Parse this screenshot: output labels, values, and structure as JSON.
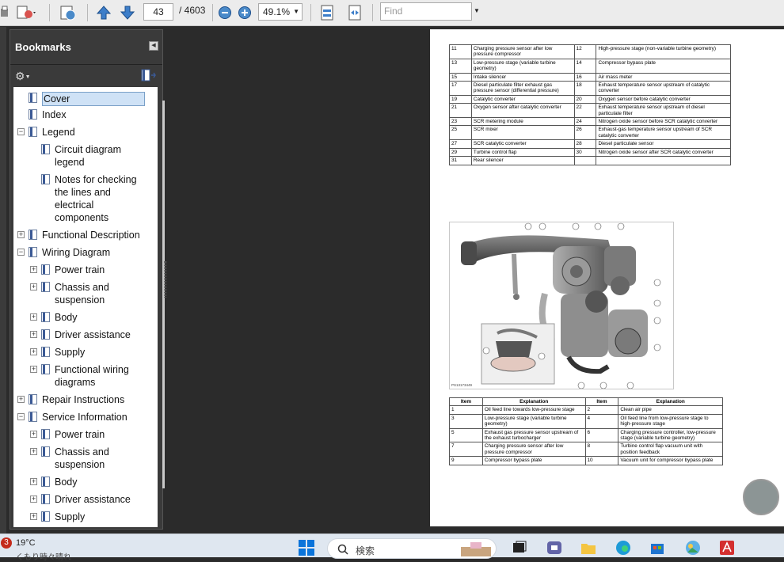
{
  "toolbar": {
    "page_current": "43",
    "page_total": "/ 4603",
    "zoom": "49.1%",
    "find_placeholder": "Find"
  },
  "bookmarks": {
    "title": "Bookmarks",
    "items": [
      {
        "label": "Cover",
        "level": 0,
        "expander": "none",
        "selected": true
      },
      {
        "label": "Index",
        "level": 0,
        "expander": "none"
      },
      {
        "label": "Legend",
        "level": 0,
        "expander": "minus"
      },
      {
        "label": "Circuit diagram legend",
        "level": 1,
        "expander": "none"
      },
      {
        "label": "Notes for checking the lines and electrical components",
        "level": 1,
        "expander": "none"
      },
      {
        "label": "Functional Description",
        "level": 0,
        "expander": "plus"
      },
      {
        "label": "Wiring Diagram",
        "level": 0,
        "expander": "minus"
      },
      {
        "label": "Power train",
        "level": 1,
        "expander": "plus"
      },
      {
        "label": "Chassis and suspension",
        "level": 1,
        "expander": "plus"
      },
      {
        "label": "Body",
        "level": 1,
        "expander": "plus"
      },
      {
        "label": "Driver assistance",
        "level": 1,
        "expander": "plus"
      },
      {
        "label": "Supply",
        "level": 1,
        "expander": "plus"
      },
      {
        "label": "Functional wiring diagrams",
        "level": 1,
        "expander": "plus"
      },
      {
        "label": "Repair Instructions",
        "level": 0,
        "expander": "plus"
      },
      {
        "label": "Service Information",
        "level": 0,
        "expander": "minus"
      },
      {
        "label": "Power train",
        "level": 1,
        "expander": "plus"
      },
      {
        "label": "Chassis and suspension",
        "level": 1,
        "expander": "plus"
      },
      {
        "label": "Body",
        "level": 1,
        "expander": "plus"
      },
      {
        "label": "Driver assistance",
        "level": 1,
        "expander": "plus"
      },
      {
        "label": "Supply",
        "level": 1,
        "expander": "plus"
      }
    ]
  },
  "doc": {
    "top_table": [
      [
        "11",
        "Charging pressure sensor after low pressure compressor",
        "12",
        "High-pressure stage (non-variable turbine geometry)"
      ],
      [
        "13",
        "Low-pressure stage (variable turbine geometry)",
        "14",
        "Compressor bypass plate"
      ],
      [
        "15",
        "Intake silencer",
        "16",
        "Air mass meter"
      ],
      [
        "17",
        "Diesel particulate filter exhaust gas pressure sensor (differential pressure)",
        "18",
        "Exhaust temperature sensor upstream of catalytic converter"
      ],
      [
        "19",
        "Catalytic converter",
        "20",
        "Oxygen sensor before catalytic converter"
      ],
      [
        "21",
        "Oxygen sensor after catalytic converter",
        "22",
        "Exhaust temperature sensor upstream of diesel particulate filter"
      ],
      [
        "23",
        "SCR metering module",
        "24",
        "Nitrogen oxide sensor before SCR catalytic converter"
      ],
      [
        "25",
        "SCR mixer",
        "26",
        "Exhaust-gas temperature sensor upstream of SCR catalytic converter"
      ],
      [
        "27",
        "SCR catalytic converter",
        "28",
        "Diesel particulate sensor"
      ],
      [
        "29",
        "Turbine control flap",
        "30",
        "Nitrogen oxide sensor after SCR catalytic converter"
      ],
      [
        "31",
        "Rear silencer",
        "",
        ""
      ]
    ],
    "figure_ref": "PS13173449",
    "bottom_header": [
      "Item",
      "Explanation",
      "Item",
      "Explanation"
    ],
    "bottom_table": [
      [
        "1",
        "Oil feed line towards low-pressure stage",
        "2",
        "Clean air pipe"
      ],
      [
        "3",
        "Low-pressure stage (variable turbine geometry)",
        "4",
        "Oil feed line from low-pressure stage to high-pressure stage"
      ],
      [
        "5",
        "Exhaust gas pressure sensor upstream of the exhaust turbocharger",
        "6",
        "Charging pressure controller, low-pressure stage (variable turbine geometry)"
      ],
      [
        "7",
        "Charging pressure sensor after low pressure compressor",
        "8",
        "Turbine control flap vacuum unit with position feedback"
      ],
      [
        "9",
        "Compressor bypass plate",
        "10",
        "Vacuum unit for compressor bypass plate"
      ]
    ]
  },
  "taskbar": {
    "notification_count": "3",
    "temperature": "19°C",
    "weather": "くもり時々晴れ",
    "search_label": "検索"
  }
}
